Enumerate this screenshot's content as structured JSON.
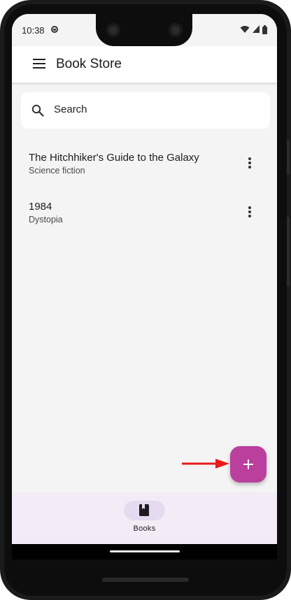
{
  "status_bar": {
    "time": "10:38"
  },
  "app_bar": {
    "title": "Book Store"
  },
  "search": {
    "placeholder": "Search"
  },
  "books": [
    {
      "title": "The Hitchhiker's Guide to the Galaxy",
      "genre": "Science fiction"
    },
    {
      "title": "1984",
      "genre": "Dystopia"
    }
  ],
  "bottom_nav": {
    "items": [
      {
        "label": "Books",
        "icon": "book-icon",
        "selected": true
      }
    ]
  },
  "colors": {
    "fab": "#bb3f9d",
    "nav_background": "#f3ecf6",
    "nav_indicator": "#e6daf1",
    "annotation_arrow": "#e81b1b"
  }
}
